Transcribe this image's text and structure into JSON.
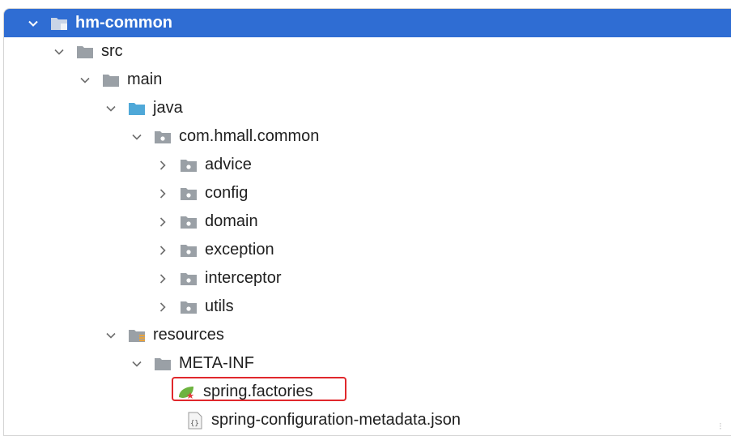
{
  "colors": {
    "selection": "#2f6dd3",
    "highlight_box": "#e0282c",
    "folder": "#9aa0a6",
    "source_folder": "#4fa8d8"
  },
  "tree": [
    {
      "label": "hm-common",
      "icon": "module-folder-icon",
      "expanded": true,
      "selected": true
    },
    {
      "label": "src",
      "icon": "folder-icon",
      "expanded": true
    },
    {
      "label": "main",
      "icon": "folder-icon",
      "expanded": true
    },
    {
      "label": "java",
      "icon": "source-folder-icon",
      "expanded": true
    },
    {
      "label": "com.hmall.common",
      "icon": "package-icon",
      "expanded": true
    },
    {
      "label": "advice",
      "icon": "package-icon",
      "expanded": false
    },
    {
      "label": "config",
      "icon": "package-icon",
      "expanded": false
    },
    {
      "label": "domain",
      "icon": "package-icon",
      "expanded": false
    },
    {
      "label": "exception",
      "icon": "package-icon",
      "expanded": false
    },
    {
      "label": "interceptor",
      "icon": "package-icon",
      "expanded": false
    },
    {
      "label": "utils",
      "icon": "package-icon",
      "expanded": false
    },
    {
      "label": "resources",
      "icon": "resources-folder-icon",
      "expanded": true
    },
    {
      "label": "META-INF",
      "icon": "folder-icon",
      "expanded": true
    },
    {
      "label": "spring.factories",
      "icon": "spring-file-icon",
      "highlighted": true
    },
    {
      "label": "spring-configuration-metadata.json",
      "icon": "json-file-icon"
    }
  ]
}
